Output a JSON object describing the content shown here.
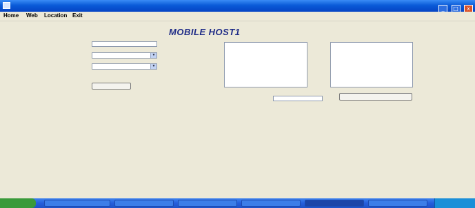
{
  "window": {
    "title": "",
    "icon": "app-icon",
    "buttons": {
      "minimize_icon": "minimize-icon",
      "maximize_icon": "maximize-icon",
      "close_icon": "close-icon",
      "minimize": "_",
      "maximize": "□",
      "close": "x"
    }
  },
  "menu": {
    "items": [
      {
        "label": "Home"
      },
      {
        "label": "Web"
      },
      {
        "label": "Location"
      },
      {
        "label": "Exit"
      }
    ]
  },
  "main": {
    "heading": "MOBILE HOST1",
    "form": {
      "port_label": "",
      "port_value": "",
      "query_label": "",
      "query_value": "",
      "third_label": "",
      "third_value": "",
      "submit_label": ""
    },
    "query_panel": {
      "header": "",
      "items": [
        "",
        "",
        "",
        ""
      ]
    },
    "results_panel": {
      "header": "",
      "links": [
        "",
        ""
      ]
    },
    "response": {
      "label": "",
      "value": ""
    },
    "reset_button": ""
  },
  "taskbar": {
    "colors": {
      "bar": "#245edb",
      "start": "#3a9a3a",
      "tray": "#1b8fd8"
    },
    "tasks": [
      "",
      "",
      "",
      "",
      "",
      ""
    ]
  }
}
